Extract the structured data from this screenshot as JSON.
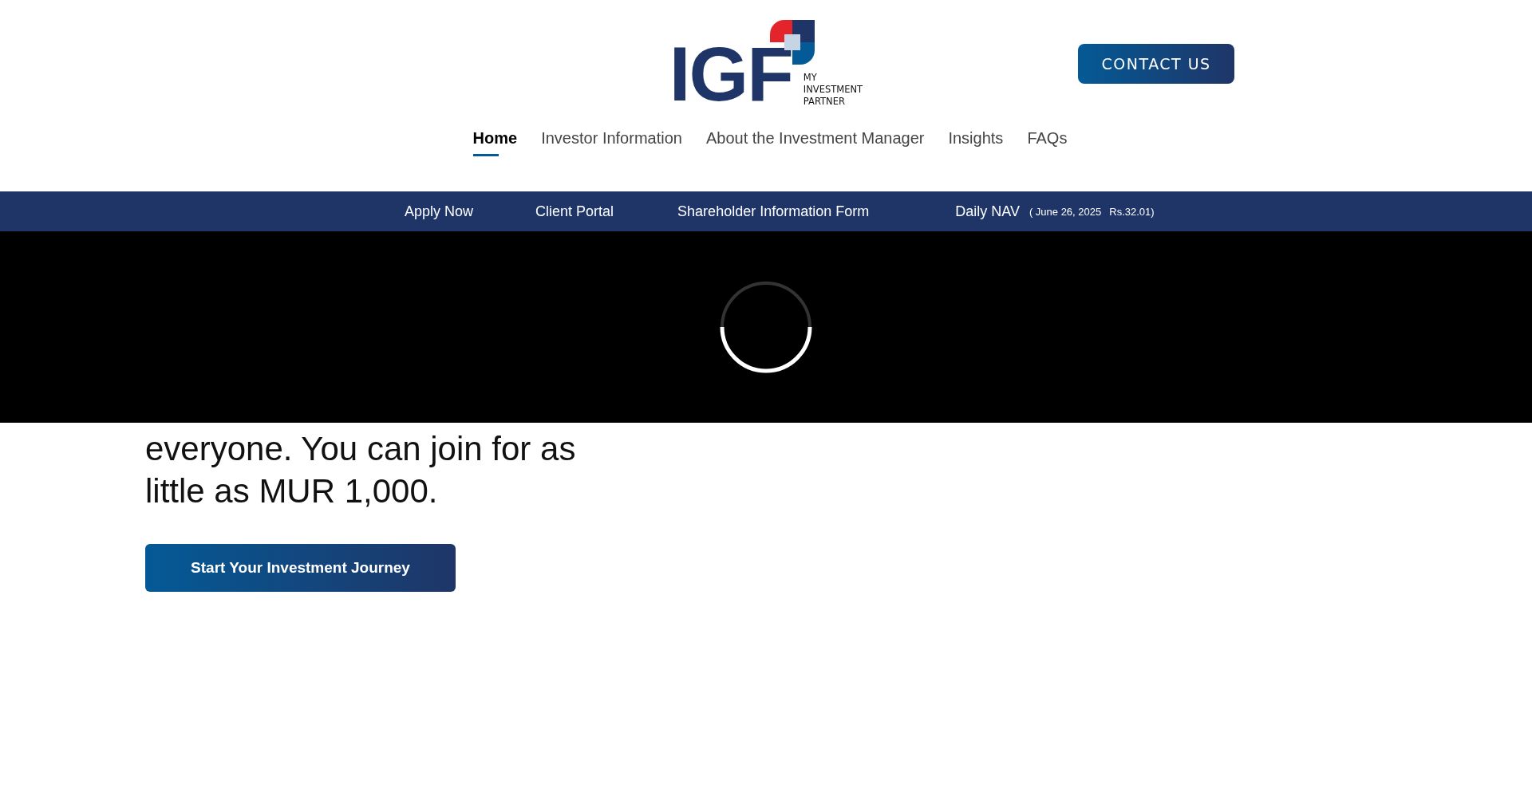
{
  "header": {
    "logo": {
      "letters": "IGF",
      "tagline": [
        "MY",
        "INVESTMENT",
        "PARTNER"
      ]
    },
    "contact_button": "CONTACT US"
  },
  "nav": [
    {
      "label": "Home",
      "selected": true
    },
    {
      "label": "Investor Information",
      "selected": false
    },
    {
      "label": "About the Investment Manager",
      "selected": false
    },
    {
      "label": "Insights",
      "selected": false
    },
    {
      "label": "FAQs",
      "selected": false
    }
  ],
  "sub_bar": {
    "links": [
      "Apply Now",
      "Client Portal",
      "Shareholder Information Form"
    ],
    "daily_nav": {
      "label": "Daily NAV",
      "date": "( June 26, 2025",
      "price": "Rs.32.01)"
    }
  },
  "video": {
    "loading": true
  },
  "hero": {
    "text": "everyone. You can join for as little as MUR 1,000.",
    "button": "Start Your Investment Journey"
  }
}
